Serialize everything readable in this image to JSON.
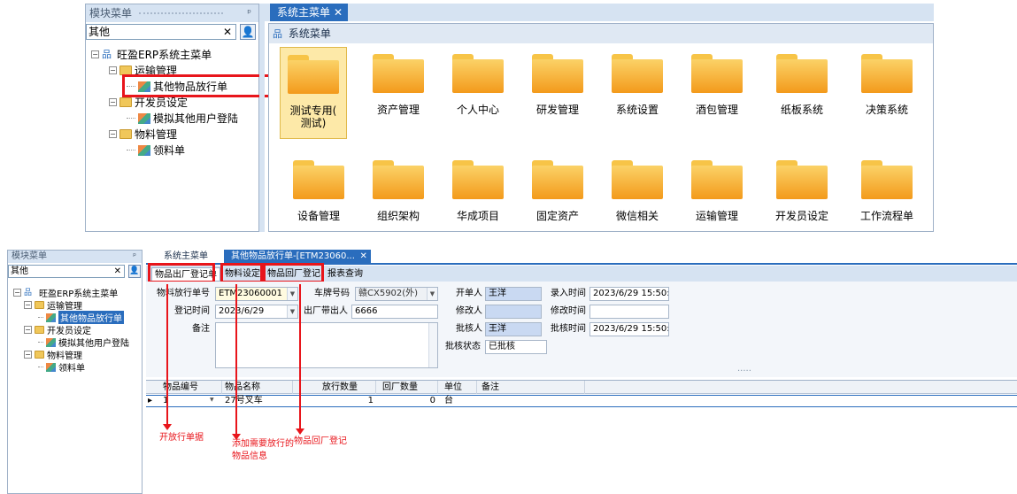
{
  "top": {
    "left_panel": {
      "title": "模块菜单",
      "pin": "ᵖ",
      "search_value": "其他",
      "tree": {
        "root": "旺盈ERP系统主菜单",
        "groups": [
          {
            "label": "运输管理",
            "items": [
              "其他物品放行单"
            ]
          },
          {
            "label": "开发员设定",
            "items": [
              "模拟其他用户登陆"
            ]
          },
          {
            "label": "物料管理",
            "items": [
              "领料单"
            ]
          }
        ]
      }
    },
    "tabs": [
      {
        "label": "系统主菜单",
        "close": "✕"
      }
    ],
    "menu_header": "系统菜单",
    "tiles_row1": [
      "测试专用(\n测试)",
      "资产管理",
      "个人中心",
      "研发管理",
      "系统设置",
      "酒包管理",
      "纸板系统",
      "决策系统"
    ],
    "tiles_row2": [
      "设备管理",
      "组织架构",
      "华成项目",
      "固定资产",
      "微信相关",
      "运输管理",
      "开发员设定",
      "工作流程单"
    ]
  },
  "bottom": {
    "left_panel": {
      "title": "模块菜单",
      "pin": "ᵖ",
      "search_value": "其他",
      "tree": {
        "root": "旺盈ERP系统主菜单",
        "groups": [
          {
            "label": "运输管理",
            "items": [
              "其他物品放行单"
            ]
          },
          {
            "label": "开发员设定",
            "items": [
              "模拟其他用户登陆"
            ]
          },
          {
            "label": "物料管理",
            "items": [
              "领料单"
            ]
          }
        ]
      }
    },
    "tabs": [
      {
        "label": "系统主菜单"
      },
      {
        "label": "其他物品放行单-[ETM23060...",
        "close": "✕"
      }
    ],
    "subtabs": [
      "物品出厂登记单",
      "物料设定",
      "物品回厂登记",
      "报表查询"
    ],
    "form": {
      "pass_no_label": "物料放行单号",
      "pass_no": "ETM23060001",
      "plate_label": "车牌号码",
      "plate": "赣CX5902(外)",
      "opener_label": "开单人",
      "opener": "王洋",
      "entry_time_label": "录入时间",
      "entry_time": "2023/6/29 15:50:2",
      "reg_time_label": "登记时间",
      "reg_time": "2023/6/29",
      "out_person_label": "出厂带出人",
      "out_person": "6666",
      "modifier_label": "修改人",
      "modifier": "",
      "modify_time_label": "修改时间",
      "modify_time": "",
      "note_label": "备注",
      "approver_label": "批核人",
      "approver": "王洋",
      "approve_time_label": "批核时间",
      "approve_time": "2023/6/29 15:50:2",
      "approve_status_label": "批核状态",
      "approve_status": "已批核",
      "dots": "....."
    },
    "grid": {
      "columns": [
        "物品编号",
        "物品名称",
        "放行数量",
        "回厂数量",
        "单位",
        "备注"
      ],
      "rows": [
        {
          "code": "1",
          "name": "27号叉车",
          "qty": "1",
          "ret": "0",
          "unit": "台",
          "note": ""
        }
      ]
    },
    "annotations": {
      "a1": "开放行单据",
      "a2": "添加需要放行的\n物品信息",
      "a3": "物品回厂登记"
    }
  }
}
